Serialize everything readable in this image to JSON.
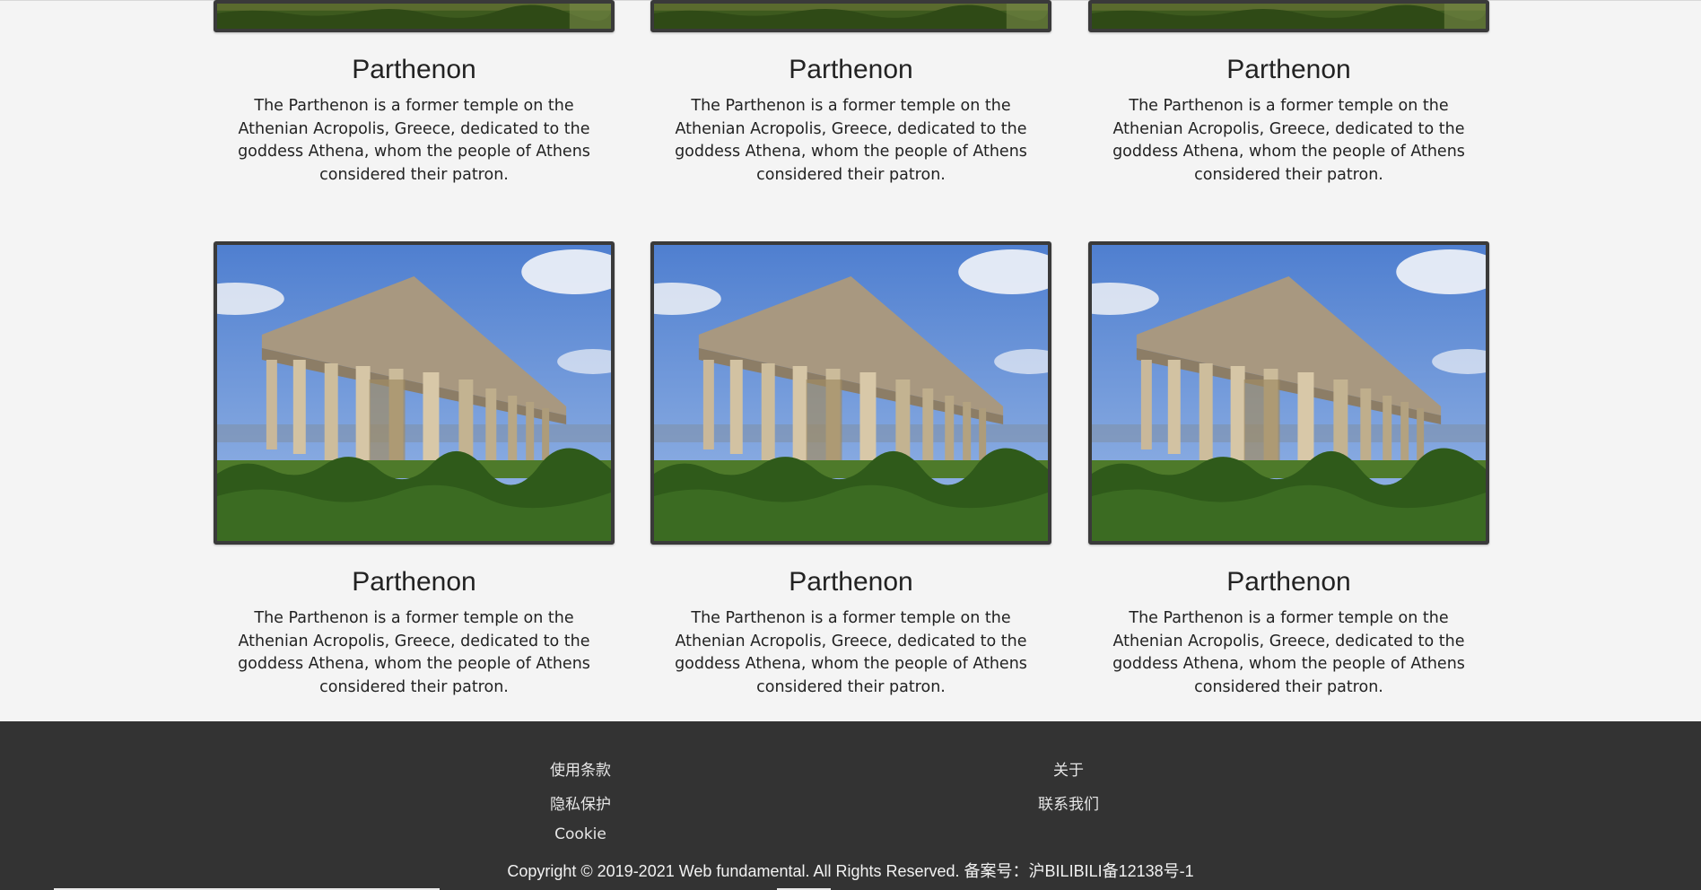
{
  "gallery": {
    "cards": [
      {
        "title": "Parthenon",
        "description": "The Parthenon is a former temple on the Athenian Acropolis, Greece, dedicated to the goddess Athena, whom the people of Athens considered their patron."
      },
      {
        "title": "Parthenon",
        "description": "The Parthenon is a former temple on the Athenian Acropolis, Greece, dedicated to the goddess Athena, whom the people of Athens considered their patron."
      },
      {
        "title": "Parthenon",
        "description": "The Parthenon is a former temple on the Athenian Acropolis, Greece, dedicated to the goddess Athena, whom the people of Athens considered their patron."
      },
      {
        "title": "Parthenon",
        "description": "The Parthenon is a former temple on the Athenian Acropolis, Greece, dedicated to the goddess Athena, whom the people of Athens considered their patron."
      },
      {
        "title": "Parthenon",
        "description": "The Parthenon is a former temple on the Athenian Acropolis, Greece, dedicated to the goddess Athena, whom the people of Athens considered their patron."
      },
      {
        "title": "Parthenon",
        "description": "The Parthenon is a former temple on the Athenian Acropolis, Greece, dedicated to the goddess Athena, whom the people of Athens considered their patron."
      }
    ]
  },
  "footer": {
    "links": {
      "terms": "使用条款",
      "privacy": "隐私保护",
      "cookie": "Cookie",
      "about": "关于",
      "contact": "联系我们"
    },
    "copyright": "Copyright © 2019-2021 Web fundamental. All Rights Reserved. 备案号：沪BILIBILI备12138号-1"
  },
  "colors": {
    "page_background": "#f4f4f4",
    "footer_background": "#333333",
    "photo_border": "#3a3a3a",
    "text": "#222222",
    "footer_text": "#e6e6e6"
  }
}
